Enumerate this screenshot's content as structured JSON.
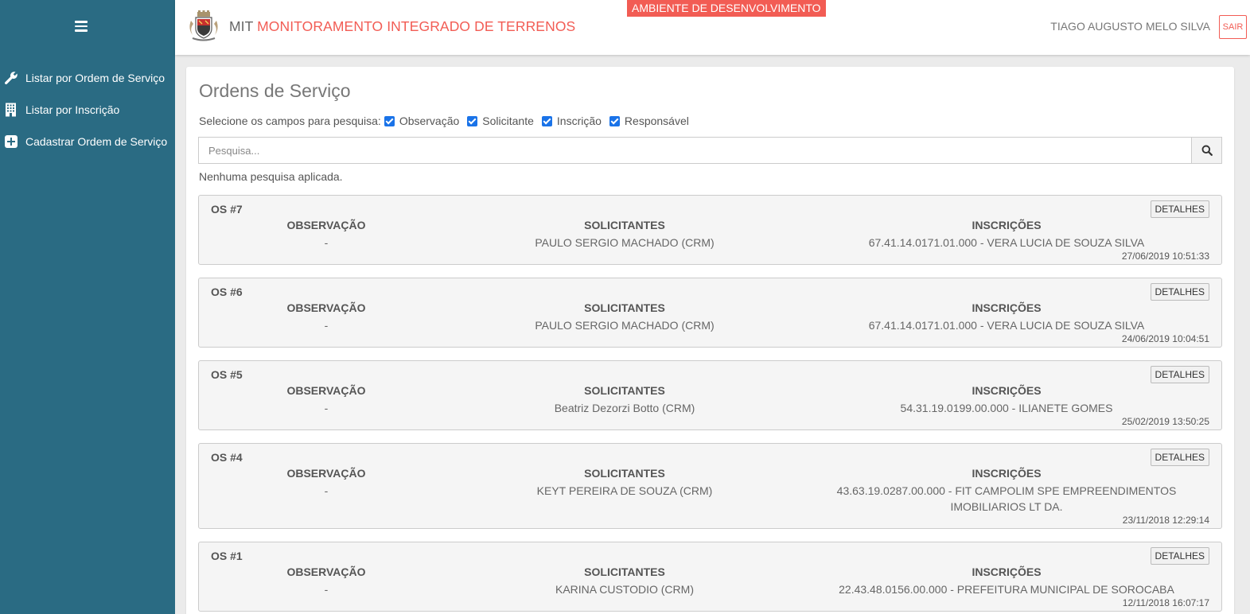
{
  "sidebar": {
    "items": [
      {
        "label": "Listar por Ordem de Serviço",
        "icon": "wrench-icon"
      },
      {
        "label": "Listar por Inscrição",
        "icon": "building-icon"
      },
      {
        "label": "Cadastrar Ordem de Serviço",
        "icon": "plus-square-icon"
      }
    ]
  },
  "header": {
    "title_prefix": "MIT",
    "title_accent": "MONITORAMENTO INTEGRADO DE TERRENOS",
    "env_badge": "AMBIENTE DE DESENVOLVIMENTO",
    "user_name": "TIAGO AUGUSTO MELO SILVA",
    "logout_label": "SAIR"
  },
  "colors": {
    "sidebar": "#2a6b83",
    "accent": "#f25c54",
    "checkbox": "#1a73e8"
  },
  "main": {
    "title": "Ordens de Serviço",
    "filters_label": "Selecione os campos para pesquisa:",
    "filters": [
      "Observação",
      "Solicitante",
      "Inscrição",
      "Responsável"
    ],
    "search_placeholder": "Pesquisa...",
    "no_search": "Nenhuma pesquisa aplicada.",
    "col_headers": {
      "obs": "OBSERVAÇÃO",
      "sol": "SOLICITANTES",
      "insc": "INSCRIÇÕES"
    },
    "details_label": "DETALHES",
    "orders": [
      {
        "id": "OS #7",
        "obs": "-",
        "sol": "PAULO SERGIO MACHADO (CRM)",
        "insc": "67.41.14.0171.01.000 - VERA LUCIA DE SOUZA SILVA",
        "date": "27/06/2019 10:51:33"
      },
      {
        "id": "OS #6",
        "obs": "-",
        "sol": "PAULO SERGIO MACHADO (CRM)",
        "insc": "67.41.14.0171.01.000 - VERA LUCIA DE SOUZA SILVA",
        "date": "24/06/2019 10:04:51"
      },
      {
        "id": "OS #5",
        "obs": "-",
        "sol": "Beatriz Dezorzi Botto (CRM)",
        "insc": "54.31.19.0199.00.000 - ILIANETE GOMES",
        "date": "25/02/2019 13:50:25"
      },
      {
        "id": "OS #4",
        "obs": "-",
        "sol": "KEYT PEREIRA DE SOUZA (CRM)",
        "insc": "43.63.19.0287.00.000 - FIT CAMPOLIM SPE EMPREENDIMENTOS IMOBILIARIOS LT DA.",
        "date": "23/11/2018 12:29:14"
      },
      {
        "id": "OS #1",
        "obs": "-",
        "sol": "KARINA CUSTODIO (CRM)",
        "insc": "22.43.48.0156.00.000 - PREFEITURA MUNICIPAL DE SOROCABA",
        "date": "12/11/2018 16:07:17"
      }
    ]
  }
}
